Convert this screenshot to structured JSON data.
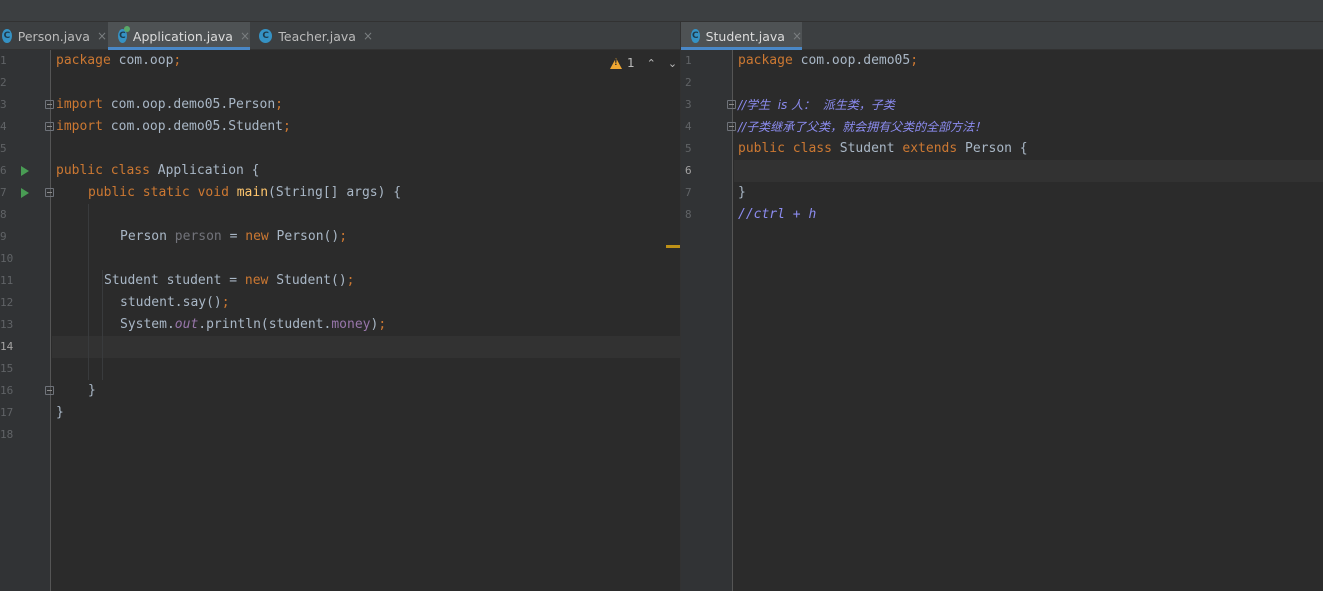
{
  "colors": {
    "background": "#2b2b2b",
    "tab_accent": "#4a88c7",
    "keyword": "#cc7832",
    "comment": "#8c8cf0"
  },
  "left_editor": {
    "tabs": [
      {
        "label": "Person.java",
        "icon": "class-c-icon",
        "close": "×"
      },
      {
        "label": "Application.java",
        "icon": "class-c-icon",
        "close": "×",
        "active": true
      },
      {
        "label": "Teacher.java",
        "icon": "class-c-icon",
        "close": "×"
      }
    ],
    "inspection": {
      "warning_count": "1",
      "up": "⌃",
      "down": "⌄"
    },
    "line_numbers": [
      "1",
      "2",
      "3",
      "4",
      "5",
      "6",
      "7",
      "8",
      "9",
      "10",
      "11",
      "12",
      "13",
      "14",
      "15",
      "16",
      "17",
      "18"
    ],
    "code": {
      "l1_kw": "package",
      "l1_rest": " com.oop",
      "l1_semi": ";",
      "l3_kw": "import",
      "l3_rest": " com.oop.demo05.Person",
      "l3_semi": ";",
      "l4_kw": "import",
      "l4_rest": " com.oop.demo05.Student",
      "l4_semi": ";",
      "l6_kw1": "public",
      "l6_kw2": "class",
      "l6_rest": " Application {",
      "l7_kw1": "public",
      "l7_kw2": "static",
      "l7_kw3": "void",
      "l7_fn": "main",
      "l7_rest": "(String[] args) {",
      "l9_type": "Person ",
      "l9_var": "person",
      "l9_eq": " = ",
      "l9_new": "new",
      "l9_rest": " Person()",
      "l9_semi": ";",
      "l11_type": "Student student = ",
      "l11_new": "new",
      "l11_rest": " Student()",
      "l11_semi": ";",
      "l12_code": "student.say()",
      "l12_semi": ";",
      "l13_a": "System.",
      "l13_out": "out",
      "l13_b": ".println(student.",
      "l13_fld": "money",
      "l13_c": ")",
      "l13_semi": ";",
      "l16": "}",
      "l17": "}"
    }
  },
  "right_editor": {
    "tabs": [
      {
        "label": "Student.java",
        "icon": "class-c-icon",
        "close": "×",
        "active": true
      }
    ],
    "line_numbers": [
      "1",
      "2",
      "3",
      "4",
      "5",
      "6",
      "7",
      "8"
    ],
    "code": {
      "l1_kw": "package",
      "l1_rest": " com.oop.demo05",
      "l1_semi": ";",
      "l3_comment": "//学生  is 人：  派生类，子类",
      "l4_comment": "//子类继承了父类，就会拥有父类的全部方法！",
      "l5_kw1": "public",
      "l5_kw2": "class",
      "l5_rest1": " Student ",
      "l5_kw3": "extends",
      "l5_rest2": " Person {",
      "l7": "}",
      "l8_comment": "//ctrl + h"
    }
  }
}
